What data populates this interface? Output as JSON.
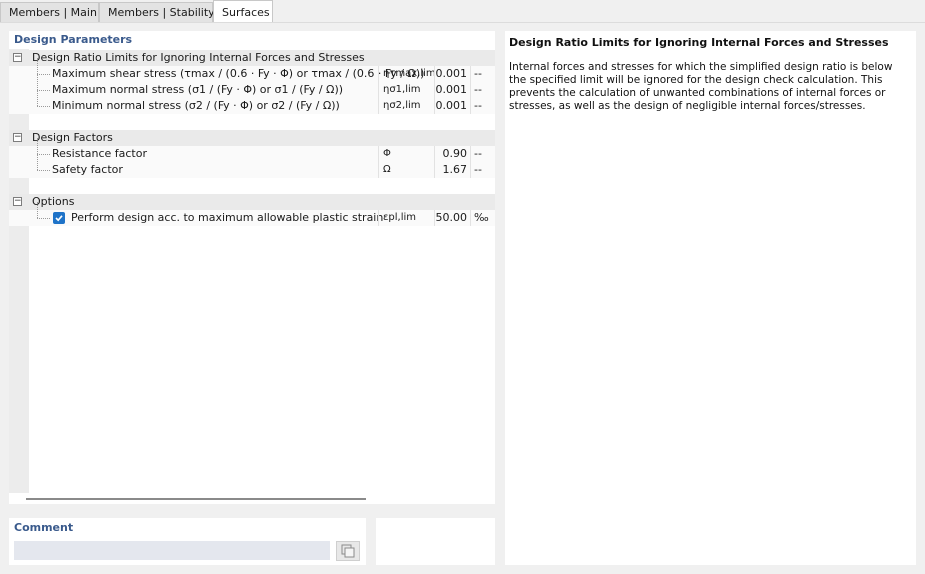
{
  "tabs": [
    {
      "label": "Members | Main",
      "active": false
    },
    {
      "label": "Members | Stability",
      "active": false
    },
    {
      "label": "Surfaces",
      "active": true
    }
  ],
  "params": {
    "header": "Design Parameters",
    "groups": [
      {
        "label": "Design Ratio Limits for Ignoring Internal Forces and Stresses",
        "rows": [
          {
            "label": "Maximum shear stress (τmax / (0.6 · Fy · Φ) or τmax / (0.6 · Fy / Ω))",
            "symbol": "ητmax,lim",
            "value": "0.001",
            "unit": "--"
          },
          {
            "label": "Maximum normal stress (σ1 / (Fy · Φ) or σ1 / (Fy / Ω))",
            "symbol": "ησ1,lim",
            "value": "0.001",
            "unit": "--"
          },
          {
            "label": "Minimum normal stress (σ2 / (Fy · Φ) or σ2 / (Fy / Ω))",
            "symbol": "ησ2,lim",
            "value": "0.001",
            "unit": "--"
          }
        ]
      },
      {
        "label": "Design Factors",
        "rows": [
          {
            "label": "Resistance factor",
            "symbol": "Φ",
            "value": "0.90",
            "unit": "--"
          },
          {
            "label": "Safety factor",
            "symbol": "Ω",
            "value": "1.67",
            "unit": "--"
          }
        ]
      },
      {
        "label": "Options",
        "rows": [
          {
            "label": "Perform design acc. to maximum allowable plastic strain",
            "symbol": "εpl,lim",
            "value": "50.00",
            "unit": "‰",
            "checked": true
          }
        ]
      }
    ]
  },
  "comment": {
    "title": "Comment",
    "value": ""
  },
  "description": {
    "title": "Design Ratio Limits for Ignoring Internal Forces and Stresses",
    "text": "Internal forces and stresses for which the simplified design ratio is below the specified limit will be ignored for the design check calculation. This prevents the calculation of unwanted combinations of internal forces or stresses, as well as the design of negligible internal forces/stresses."
  },
  "colors": {
    "accent": "#1e73c8",
    "header_text": "#3a5a8c"
  }
}
